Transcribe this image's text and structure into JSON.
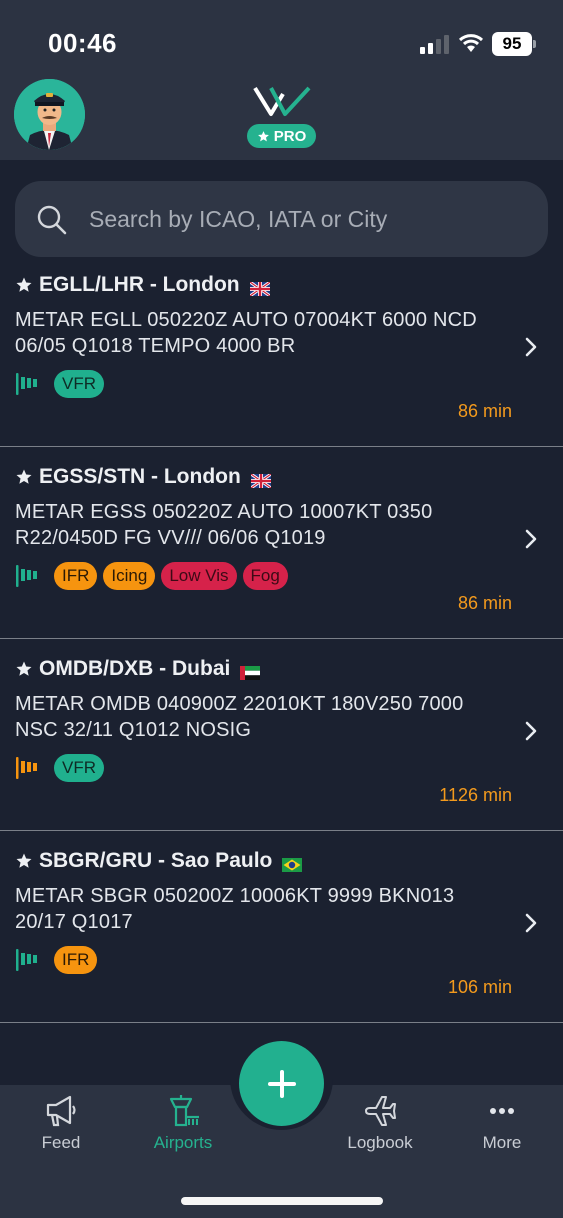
{
  "status": {
    "time": "00:46",
    "battery": "95"
  },
  "header": {
    "pro_label": "PRO",
    "avatar_icon": "pilot-avatar-icon",
    "logo_icon": "app-logo-icon"
  },
  "search": {
    "placeholder": "Search by ICAO, IATA or City"
  },
  "colors": {
    "accent": "#25b28f",
    "vfr": "#20b08e",
    "ifr": "#f6940f",
    "warning_red": "#d6224a",
    "age": "#f39a1d"
  },
  "airports": [
    {
      "title": "EGLL/LHR - London",
      "flag": "uk-flag-icon",
      "metar": "METAR EGLL 050220Z AUTO 07004KT 6000 NCD 06/05 Q1018 TEMPO 4000 BR",
      "windsock_color": "#20b08e",
      "tags": [
        {
          "label": "VFR",
          "kind": "vfr"
        }
      ],
      "age": "86 min"
    },
    {
      "title": "EGSS/STN - London",
      "flag": "uk-flag-icon",
      "metar": "METAR EGSS 050220Z AUTO 10007KT 0350 R22/0450D FG VV/// 06/06 Q1019",
      "windsock_color": "#20b08e",
      "tags": [
        {
          "label": "IFR",
          "kind": "ifr"
        },
        {
          "label": "Icing",
          "kind": "icing"
        },
        {
          "label": "Low Vis",
          "kind": "lowvis"
        },
        {
          "label": "Fog",
          "kind": "fog"
        }
      ],
      "age": "86 min"
    },
    {
      "title": "OMDB/DXB - Dubai",
      "flag": "uae-flag-icon",
      "metar": "METAR OMDB 040900Z 22010KT 180V250 7000 NSC 32/11 Q1012 NOSIG",
      "windsock_color": "#f6940f",
      "tags": [
        {
          "label": "VFR",
          "kind": "vfr"
        }
      ],
      "age": "1126 min"
    },
    {
      "title": "SBGR/GRU - Sao Paulo",
      "flag": "brazil-flag-icon",
      "metar": "METAR SBGR 050200Z 10006KT 9999 BKN013 20/17 Q1017",
      "windsock_color": "#20b08e",
      "tags": [
        {
          "label": "IFR",
          "kind": "ifr"
        }
      ],
      "age": "106 min"
    }
  ],
  "tabs": [
    {
      "label": "Feed",
      "icon": "megaphone-icon",
      "active": false
    },
    {
      "label": "Airports",
      "icon": "control-tower-icon",
      "active": true
    },
    {
      "label": "Logbook",
      "icon": "airplane-icon",
      "active": false
    },
    {
      "label": "More",
      "icon": "more-dots-icon",
      "active": false
    }
  ]
}
